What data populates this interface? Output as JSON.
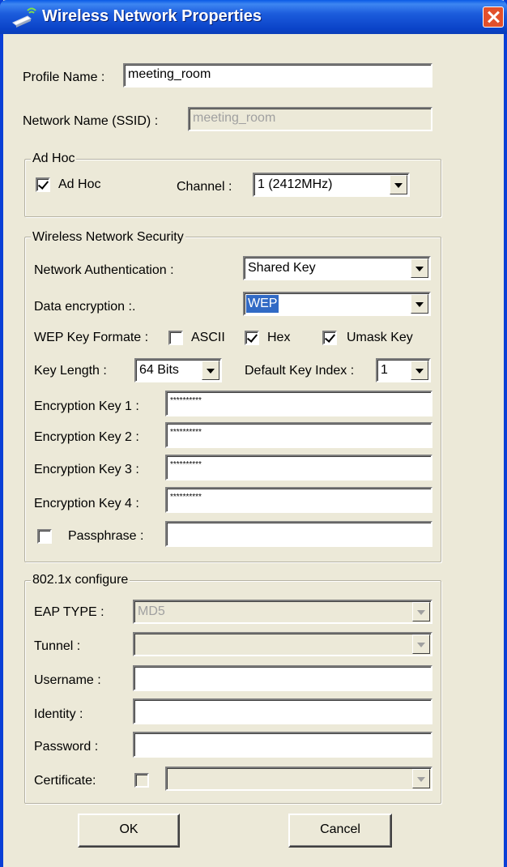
{
  "window": {
    "title": "Wireless Network Properties"
  },
  "profile": {
    "label": "Profile Name :",
    "value": "meeting_room"
  },
  "ssid": {
    "label": "Network Name (SSID) :",
    "value": "meeting_room"
  },
  "adhoc": {
    "group_label": "Ad Hoc",
    "checkbox_label": "Ad Hoc",
    "checked": true,
    "channel_label": "Channel :",
    "channel_value": "1  (2412MHz)"
  },
  "security": {
    "group_label": "Wireless Network Security",
    "auth_label": "Network Authentication :",
    "auth_value": "Shared Key",
    "encryption_label": "Data encryption :.",
    "encryption_value": "WEP",
    "key_format_label": "WEP Key Formate :",
    "ascii_label": "ASCII",
    "ascii_checked": false,
    "hex_label": "Hex",
    "hex_checked": true,
    "umask_label": "Umask Key",
    "umask_checked": true,
    "key_length_label": "Key Length :",
    "key_length_value": "64 Bits",
    "default_index_label": "Default Key Index :",
    "default_index_value": "1",
    "key1_label": "Encryption Key 1 :",
    "key1_value": "**********",
    "key2_label": "Encryption Key 2 :",
    "key2_value": "**********",
    "key3_label": "Encryption Key 3 :",
    "key3_value": "**********",
    "key4_label": "Encryption Key 4 :",
    "key4_value": "**********",
    "passphrase_label": "Passphrase :",
    "passphrase_checked": false,
    "passphrase_value": ""
  },
  "dot1x": {
    "group_label": "802.1x configure",
    "eap_label": "EAP TYPE :",
    "eap_value": "MD5",
    "tunnel_label": "Tunnel :",
    "tunnel_value": "",
    "username_label": "Username :",
    "username_value": "",
    "identity_label": "Identity :",
    "identity_value": "",
    "password_label": "Password :",
    "password_value": "",
    "certificate_label": "Certificate:",
    "certificate_value": ""
  },
  "buttons": {
    "ok": "OK",
    "cancel": "Cancel"
  }
}
